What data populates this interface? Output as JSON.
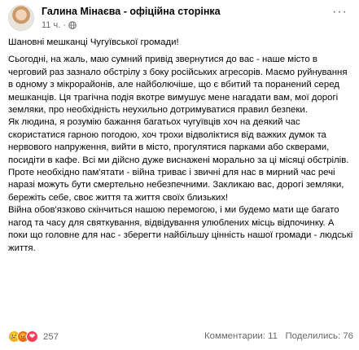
{
  "post": {
    "author": "Галина Мінаєва - офіційна сторінка",
    "time": "11 ч.",
    "audience_icon": "globe-icon",
    "more_icon": "more-options-icon",
    "greeting": "Шановні мешканці Чугуївської громади!",
    "paragraphs": [
      "Сьогодні, на жаль, маю сумний привід звернутися до вас - наше місто в черговий раз зазнало обстрілу з боку російських агресорів. Маємо руйнування в одному з мікрорайонів, але найболючіше, що є вбитий та поранений серед мешканців. Ця трагічна подія вкотре вимушує мене нагадати вам, мої дорогі земляки, про необхідність неухильно дотримуватися правил безпеки.",
      "Як людина, я розумію бажання багатьох чугуївців хоч на деякий час скористатися гарною погодою, хоч трохи відволіктися від важких думок та нервового напруження, вийти в місто, прогулятися парками або скверами, посидіти в кафе. Всі ми дійсно дуже виснажені морально за ці місяці обстрілів. Проте необхідно пам'ятати - війна триває і звичні для нас в мирний час речі наразі можуть бути смертельно небезпечними. Закликаю вас, дорогі земляки, бережіть себе, своє життя та життя своїх близьких!",
      "Війна обов'язково скінчиться нашою перемогою, і ми будемо мати ще багато нагод та часу для святкування, відвідування улюблених місць відпочинку. А поки що головне для нас - зберегти найбільшу цінність нашої громади - людські життя."
    ],
    "reactions": {
      "icons": [
        "sad",
        "angry",
        "love"
      ],
      "count": "257"
    },
    "comments": "Комментарии: 11",
    "shares": "Поделились: 76"
  }
}
